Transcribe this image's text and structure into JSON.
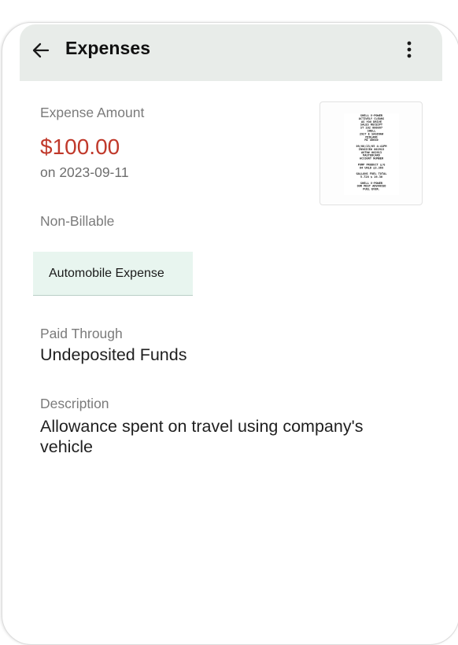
{
  "header": {
    "title": "Expenses",
    "back_icon": "arrow-left-icon",
    "menu_icon": "more-vertical-icon"
  },
  "expense": {
    "amount_label": "Expense Amount",
    "amount": "$100.00",
    "date": "on 2023-09-11",
    "billable_status": "Non-Billable",
    "category": "Automobile Expense",
    "paid_through_label": "Paid Through",
    "paid_through": "Undeposited Funds",
    "description_label": "Description",
    "description": "Allowance spent on travel using company's vehicle"
  },
  "receipt": {
    "lines": [
      "SHELL V-POWER",
      "ACTIVELY CLEANS",
      "AS YOU DRIVE",
      "SALES RECEIPT",
      "ST 102 000867",
      "SHELL",
      "2927 E SAGINAW",
      "MIDLAND",
      "MI 48640",
      "",
      "09/08/23/05  4:41PM",
      "INVOICE# 002913",
      "AUTH# 002913",
      "MASTERCARD",
      "ACCOUNT NUMBER",
      "",
      "PUMP PRODUCT   $/G",
      "04   UNLD   $3.369",
      "",
      "GALLONS   FUEL TOTAL",
      "5.728     $ 19.30",
      "",
      "SHELL V-POWER",
      "OUR MOST ADVANCED",
      "FUEL EVER."
    ]
  },
  "colors": {
    "app_bar": "#e8ece9",
    "amount": "#c0392b",
    "chip_bg": "#e8f5ef"
  }
}
